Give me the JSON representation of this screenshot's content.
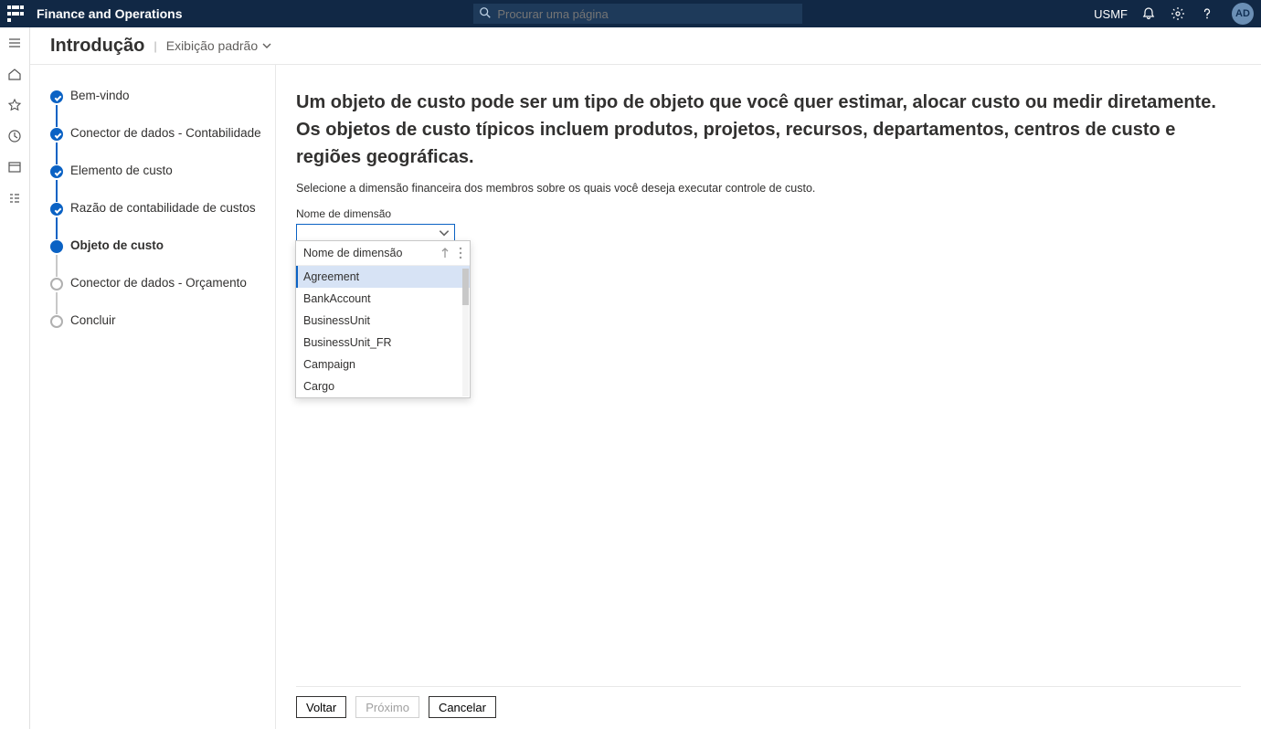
{
  "header": {
    "app_title": "Finance and Operations",
    "search_placeholder": "Procurar uma página",
    "company": "USMF",
    "avatar_initials": "AD"
  },
  "page": {
    "title": "Introdução",
    "view_label": "Exibição padrão"
  },
  "wizard": {
    "steps": [
      {
        "label": "Bem-vindo",
        "state": "completed"
      },
      {
        "label": "Conector de dados - Contabilidade",
        "state": "completed"
      },
      {
        "label": "Elemento de custo",
        "state": "completed"
      },
      {
        "label": "Razão de contabilidade de custos",
        "state": "completed"
      },
      {
        "label": "Objeto de custo",
        "state": "current"
      },
      {
        "label": "Conector de dados - Orçamento",
        "state": "future"
      },
      {
        "label": "Concluir",
        "state": "future"
      }
    ]
  },
  "content": {
    "heading": "Um objeto de custo pode ser um tipo de objeto que você quer estimar, alocar custo ou medir diretamente. Os objetos de custo típicos incluem produtos, projetos, recursos, departamentos, centros de custo e regiões geográficas.",
    "sub": "Selecione a dimensão financeira dos membros sobre os quais você deseja executar controle de custo.",
    "field_label": "Nome de dimensão",
    "combo_value": "",
    "dropdown_header": "Nome de dimensão",
    "dropdown_items": [
      "Agreement",
      "BankAccount",
      "BusinessUnit",
      "BusinessUnit_FR",
      "Campaign",
      "Cargo"
    ]
  },
  "footer": {
    "back": "Voltar",
    "next": "Próximo",
    "cancel": "Cancelar"
  }
}
